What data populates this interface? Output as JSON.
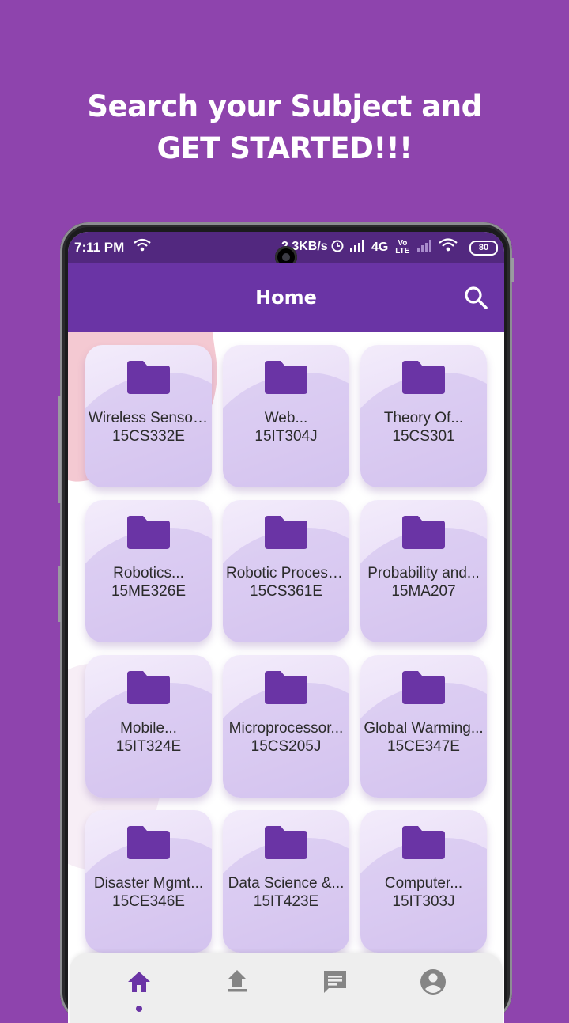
{
  "promo": {
    "line1": "Search your Subject and",
    "line2": "GET STARTED!!!"
  },
  "status_bar": {
    "time": "7:11 PM",
    "speed": "2.3KB/s",
    "network": "4G",
    "volte": "Vo LTE",
    "battery": "80"
  },
  "app_bar": {
    "title": "Home",
    "search_icon": "search-icon"
  },
  "subjects": [
    {
      "name": "Wireless Sensor...",
      "code": "15CS332E"
    },
    {
      "name": "Web...",
      "code": "15IT304J"
    },
    {
      "name": "Theory Of...",
      "code": "15CS301"
    },
    {
      "name": "Robotics...",
      "code": "15ME326E"
    },
    {
      "name": "Robotic Process...",
      "code": "15CS361E"
    },
    {
      "name": "Probability and...",
      "code": "15MA207"
    },
    {
      "name": "Mobile...",
      "code": "15IT324E"
    },
    {
      "name": "Microprocessor...",
      "code": "15CS205J"
    },
    {
      "name": "Global Warming...",
      "code": "15CE347E"
    },
    {
      "name": "Disaster Mgmt...",
      "code": "15CE346E"
    },
    {
      "name": "Data Science &...",
      "code": "15IT423E"
    },
    {
      "name": "Computer...",
      "code": "15IT303J"
    }
  ],
  "bottom_nav": {
    "items": [
      "home-icon",
      "upload-icon",
      "chat-icon",
      "account-icon"
    ],
    "active": "home-icon"
  },
  "colors": {
    "background": "#8e44ad",
    "app_bar": "#6a34a5",
    "folder": "#6a34a5",
    "tile": "#e7dbf6"
  }
}
